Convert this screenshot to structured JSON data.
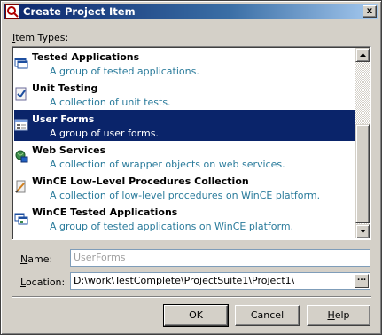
{
  "window": {
    "title": "Create Project Item",
    "close_label": "x"
  },
  "list": {
    "label_prefix": "I",
    "label_rest": "tem Types:",
    "items": [
      {
        "title": "Tested Applications",
        "desc": "A group of tested applications.",
        "icon": "tested-apps-icon",
        "selected": false
      },
      {
        "title": "Unit Testing",
        "desc": "A collection of unit tests.",
        "icon": "unit-testing-icon",
        "selected": false
      },
      {
        "title": "User Forms",
        "desc": "A group of user forms.",
        "icon": "user-forms-icon",
        "selected": true
      },
      {
        "title": "Web Services",
        "desc": "A collection of wrapper objects on web services.",
        "icon": "web-services-icon",
        "selected": false
      },
      {
        "title": "WinCE Low-Level Procedures Collection",
        "desc": "A collection of low-level procedures on WinCE platform.",
        "icon": "wince-procedures-icon",
        "selected": false
      },
      {
        "title": "WinCE Tested Applications",
        "desc": "A group of tested applications on WinCE platform.",
        "icon": "wince-apps-icon",
        "selected": false
      }
    ]
  },
  "name_field": {
    "label_prefix": "N",
    "label_rest": "ame:",
    "value": "UserForms"
  },
  "location_field": {
    "label_prefix": "L",
    "label_rest": "ocation:",
    "value": "D:\\work\\TestComplete\\ProjectSuite1\\Project1\\",
    "browse_label": "..."
  },
  "buttons": {
    "ok": "OK",
    "cancel": "Cancel",
    "help_prefix": "H",
    "help_rest": "elp"
  },
  "colors": {
    "title_gradient_start": "#0a246a",
    "selection": "#0a246a",
    "description_text": "#2a7b9b",
    "dialog_face": "#d4d0c8"
  }
}
